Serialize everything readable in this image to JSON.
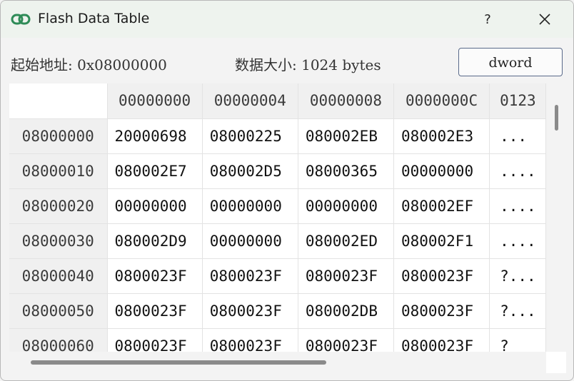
{
  "window": {
    "title": "Flash Data Table",
    "help_label": "?",
    "icon": "link-icon",
    "close_icon": "close-icon"
  },
  "info": {
    "start_address_label": "起始地址: 0x08000000",
    "data_size_label": "数据大小: 1024 bytes",
    "mode_button": "dword"
  },
  "table": {
    "columns": [
      "00000000",
      "00000004",
      "00000008",
      "0000000C",
      "0123"
    ],
    "rows": [
      {
        "addr": "08000000",
        "cells": [
          "20000698",
          "08000225",
          "080002EB",
          "080002E3"
        ],
        "ascii": "..."
      },
      {
        "addr": "08000010",
        "cells": [
          "080002E7",
          "080002D5",
          "08000365",
          "00000000"
        ],
        "ascii": "...."
      },
      {
        "addr": "08000020",
        "cells": [
          "00000000",
          "00000000",
          "00000000",
          "080002EF"
        ],
        "ascii": "...."
      },
      {
        "addr": "08000030",
        "cells": [
          "080002D9",
          "00000000",
          "080002ED",
          "080002F1"
        ],
        "ascii": "...."
      },
      {
        "addr": "08000040",
        "cells": [
          "0800023F",
          "0800023F",
          "0800023F",
          "0800023F"
        ],
        "ascii": "?..."
      },
      {
        "addr": "08000050",
        "cells": [
          "0800023F",
          "0800023F",
          "080002DB",
          "0800023F"
        ],
        "ascii": "?..."
      },
      {
        "addr": "08000060",
        "cells": [
          "0800023F",
          "0800023F",
          "0800023F",
          "0800023F"
        ],
        "ascii": "?"
      }
    ]
  }
}
